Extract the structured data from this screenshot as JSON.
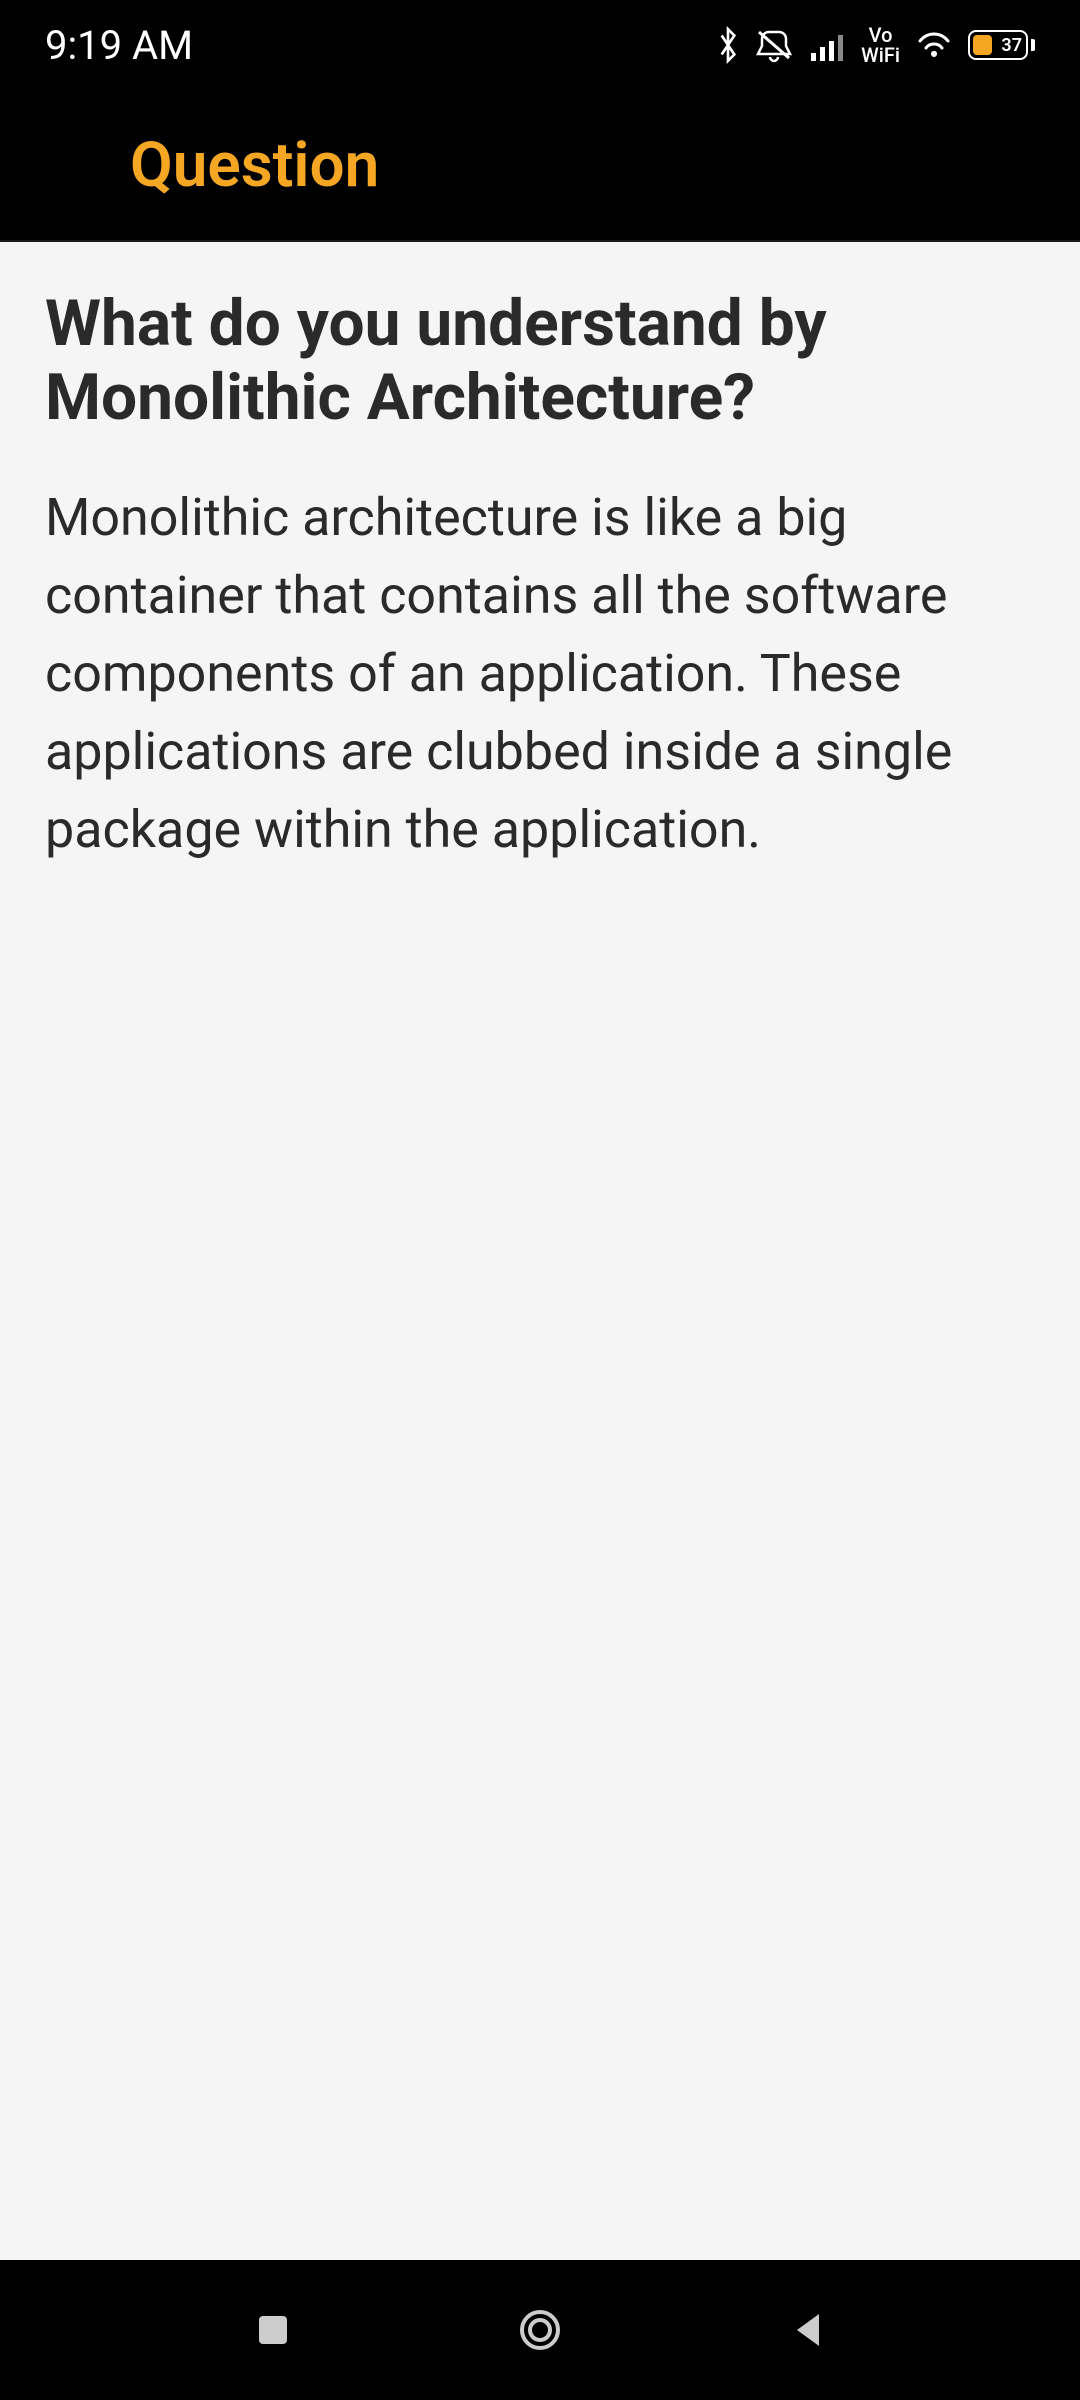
{
  "status": {
    "time": "9:19 AM",
    "vowifi_line1": "Vo",
    "vowifi_line2": "WiFi",
    "battery_percent": "37"
  },
  "header": {
    "title": "Question"
  },
  "content": {
    "question": "What do you understand by Monolithic Architecture?",
    "answer": "Monolithic architecture is like a big container that contains all the software components of an application. These applications are clubbed inside a single package within the application."
  }
}
